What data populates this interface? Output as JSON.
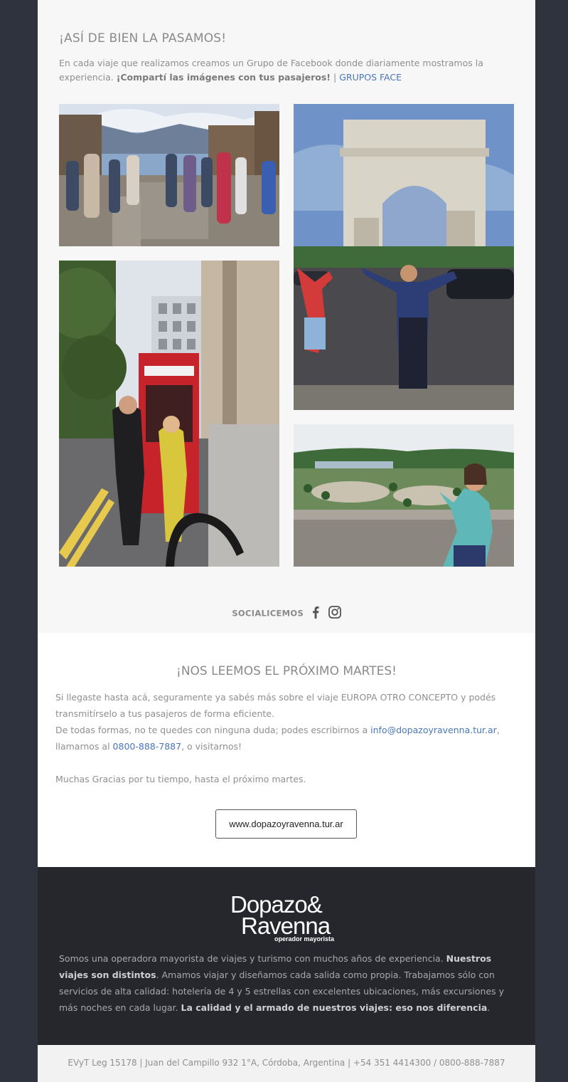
{
  "gallery": {
    "title": "¡ASÍ DE BIEN LA PASAMOS!",
    "intro_text": "En cada viaje que realizamos creamos un Grupo de Facebook donde diariamente mostramos la experiencia.",
    "intro_bold": "¡Compartí las imágenes con tus pasajeros!",
    "separator": "|",
    "link_label": "GRUPOS FACE",
    "photos": [
      {
        "name": "group-ruins-photo"
      },
      {
        "name": "arc-de-triomphe-photo"
      },
      {
        "name": "london-phone-booth-photo"
      },
      {
        "name": "versailles-gardens-photo"
      }
    ]
  },
  "social": {
    "label": "SOCIALICEMOS",
    "icons": [
      "facebook-icon",
      "instagram-icon"
    ]
  },
  "farewell": {
    "title": "¡NOS LEEMOS EL PRÓXIMO MARTES!",
    "p1": "Si llegaste hasta acá, seguramente ya sabés más sobre el viaje EUROPA OTRO CONCEPTO y podés transmitírselo a tus pasajeros de forma eficiente.",
    "p2_a": "De todas formas, no te quedes con ninguna duda; podes escribirnos a",
    "email": "info@dopazoyravenna.tur.ar",
    "p2_b": ", llamarnos al",
    "phone": "0800-888-7887",
    "p2_c": ", o visitarnos!",
    "thanks": "Muchas Gracias por tu tiempo, hasta el próximo martes.",
    "button_label": "www.dopazoyravenna.tur.ar"
  },
  "brand": {
    "logo_line1": "Dopazo&",
    "logo_line2": "Ravenna",
    "logo_line3": "operador mayorista",
    "about_1": "Somos una operadora mayorista de viajes y turismo con muchos años de experiencia.",
    "about_bold_1": "Nuestros viajes son distintos",
    "about_2": ". Amamos viajar y diseñamos cada salida como propia. Trabajamos sólo con servicios de alta calidad: hotelería de 4 y 5 estrellas con excelentes ubicaciones, más excursiones y más noches en cada lugar.",
    "about_bold_2": "La calidad y el armado de nuestros viajes: eso nos diferencia",
    "about_3": "."
  },
  "address": {
    "text": "EVyT Leg 15178 | Juan del Campillo 932 1°A, Córdoba, Argentina | +54 351 4414300 / 0800-888-7887"
  }
}
